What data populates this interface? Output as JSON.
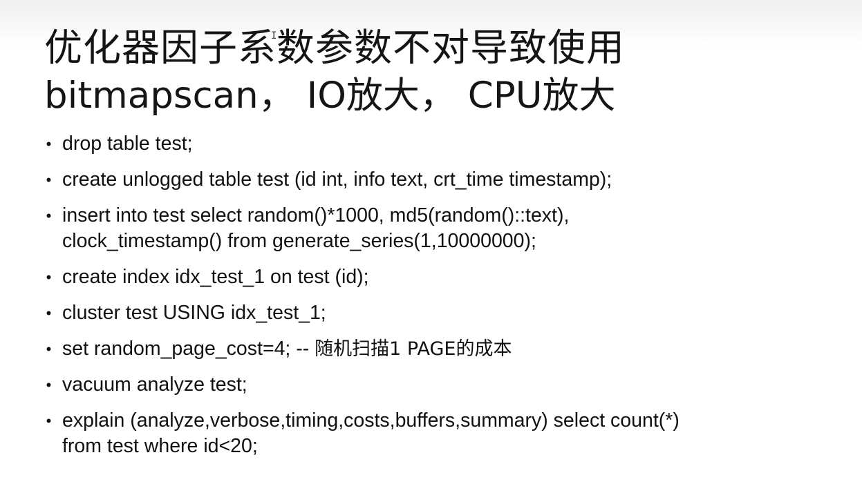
{
  "slide": {
    "title_line_1": "优化器因子系数参数不对导致使用",
    "title_line_2": "bitmapscan，  IO放大，  CPU放大",
    "bullets": [
      {
        "text": "drop table test;"
      },
      {
        "text": "create unlogged table test (id int, info text, crt_time timestamp);"
      },
      {
        "text_line_1": "insert into test select random()*1000, md5(random()::text),",
        "text_line_2": "clock_timestamp() from generate_series(1,10000000);"
      },
      {
        "text": "create index idx_test_1 on test (id);"
      },
      {
        "text": "cluster test USING idx_test_1;"
      },
      {
        "text_prefix": "set random_page_cost=4;  -- ",
        "text_suffix": "随机扫描1 PAGE的成本"
      },
      {
        "text": "vacuum analyze test;"
      },
      {
        "text_line_1": "explain (analyze,verbose,timing,costs,buffers,summary) select count(*)",
        "text_line_2": "from test where id<20;"
      }
    ],
    "bullet_symbol": "•",
    "cursor_symbol": "I"
  }
}
